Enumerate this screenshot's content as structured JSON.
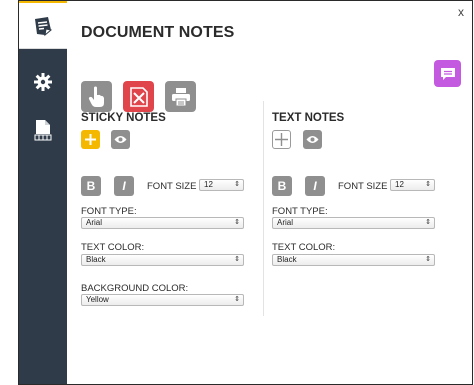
{
  "panel": {
    "title": "DOCUMENT NOTES",
    "close": "x"
  },
  "sidebar": {
    "tabs": [
      {
        "name": "notes-tab",
        "icon": "sticky-note-icon"
      },
      {
        "name": "settings-tab",
        "icon": "gear-icon"
      },
      {
        "name": "layout-tab",
        "icon": "document-grid-icon"
      }
    ]
  },
  "toolbar": {
    "buttons": [
      "hand-pointer-icon",
      "delete-note-icon",
      "print-icon",
      "comment-icon"
    ]
  },
  "sticky": {
    "title": "STICKY NOTES",
    "bold": "B",
    "italic": "I",
    "font_size_label": "FONT SIZE",
    "font_size": "12",
    "font_type_label": "FONT TYPE:",
    "font_type": "Arial",
    "text_color_label": "TEXT COLOR:",
    "text_color": "Black",
    "bg_color_label": "BACKGROUND COLOR:",
    "bg_color": "Yellow"
  },
  "text": {
    "title": "TEXT NOTES",
    "bold": "B",
    "italic": "I",
    "font_size_label": "FONT SIZE",
    "font_size": "12",
    "font_type_label": "FONT TYPE:",
    "font_type": "Arial",
    "text_color_label": "TEXT COLOR:",
    "text_color": "Black"
  },
  "colors": {
    "sidebar": "#2f3b48",
    "accent_yellow": "#f5b800",
    "delete_red": "#e0454c",
    "comment_purple": "#c45ae0",
    "button_gray": "#8f8f8f"
  }
}
